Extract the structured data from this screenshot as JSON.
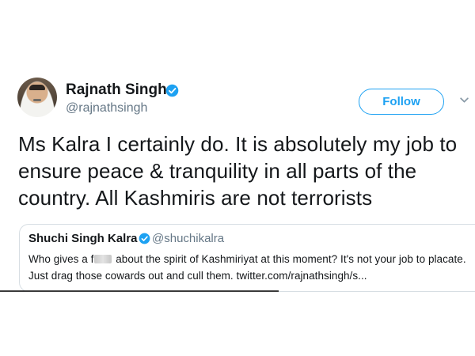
{
  "author": {
    "name": "Rajnath Singh",
    "handle": "@rajnathsingh",
    "avatar_icon": "profile-photo",
    "verified_icon": "verified-badge-icon"
  },
  "actions": {
    "follow_label": "Follow",
    "menu_icon": "chevron-down-icon"
  },
  "tweet": {
    "text": "Ms Kalra I certainly do. It is absolutely my job to ensure peace & tranquility in all parts of the country. All Kashmiris are not terrorists"
  },
  "quoted_tweet": {
    "name": "Shuchi Singh Kalra",
    "handle": "@shuchikalra",
    "text_before": "Who gives a f",
    "text_after": " about the spirit of Kashmiriyat at this moment? It's not your job to placate. Just drag those cowards out and cull them. twitter.com/rajnathsingh/s..."
  },
  "colors": {
    "accent": "#1da1f2",
    "text": "#14171a",
    "muted": "#657786",
    "border": "#d7dee3"
  }
}
